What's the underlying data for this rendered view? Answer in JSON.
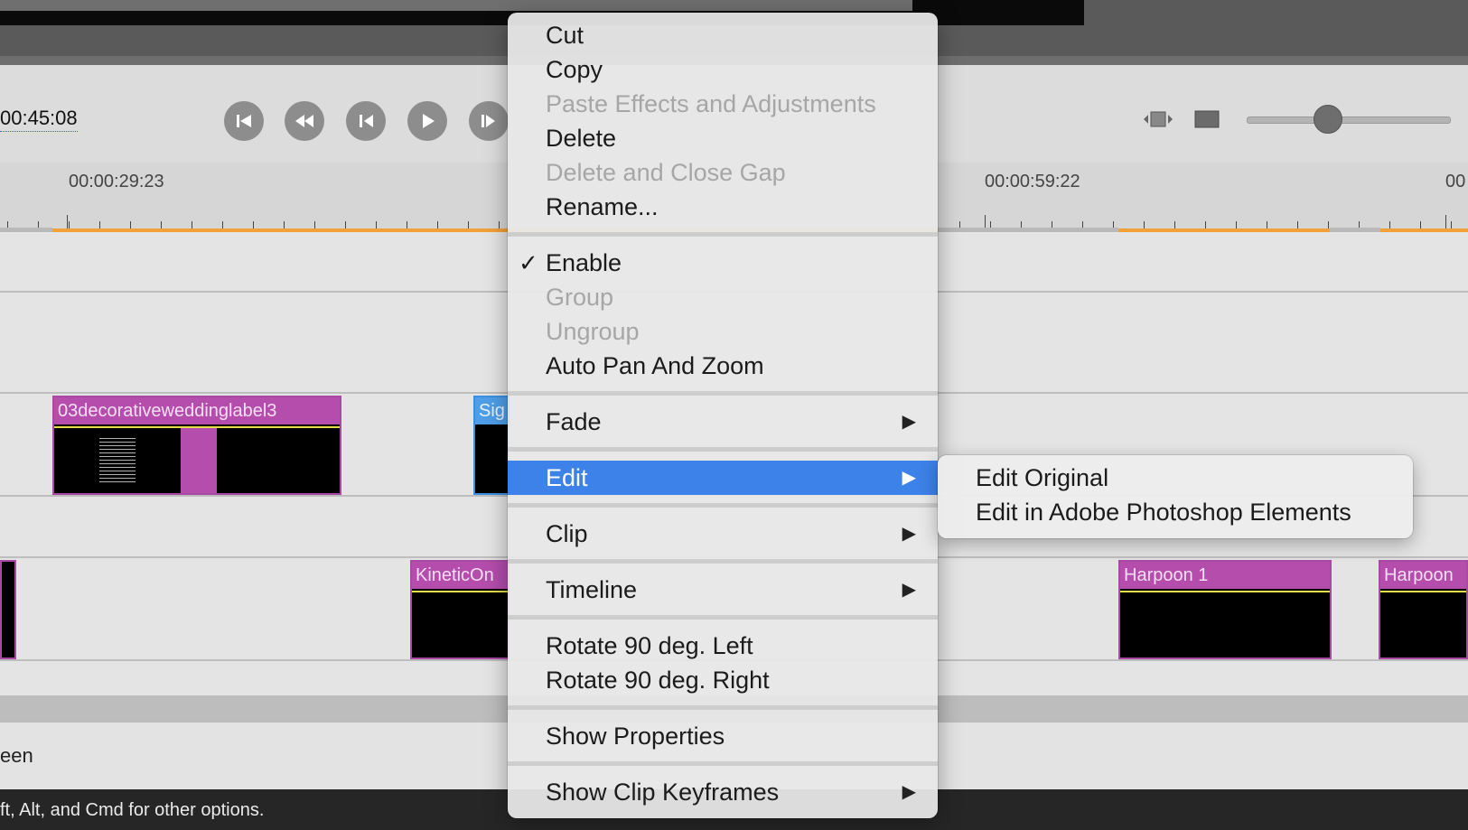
{
  "transport": {
    "timecode": "00:45:08"
  },
  "ruler": {
    "labels": [
      "00:00:29:23",
      "00:00:59:22",
      "00"
    ]
  },
  "tracks": {
    "clips": [
      {
        "name": "03decorativeweddinglabel3",
        "color": "#b44dac"
      },
      {
        "name": "Sig",
        "color": "#4f9ee8"
      },
      {
        "name": "KineticOn",
        "color": "#b44dac"
      },
      {
        "name": "Harpoon 1",
        "color": "#b44dac"
      },
      {
        "name": "Harpoon",
        "color": "#b44dac"
      }
    ]
  },
  "bottom_panel": {
    "text": "een"
  },
  "status_bar": {
    "text": "ft, Alt, and Cmd for other options."
  },
  "context_menu": {
    "items": [
      {
        "label": "Cut"
      },
      {
        "label": "Copy"
      },
      {
        "label": "Paste Effects and Adjustments",
        "disabled": true
      },
      {
        "label": "Delete"
      },
      {
        "label": "Delete and Close Gap",
        "disabled": true
      },
      {
        "label": "Rename..."
      },
      {
        "label": "Enable",
        "checked": true
      },
      {
        "label": "Group",
        "disabled": true
      },
      {
        "label": "Ungroup",
        "disabled": true
      },
      {
        "label": "Auto Pan And Zoom"
      },
      {
        "label": "Fade",
        "submenu": true
      },
      {
        "label": "Edit",
        "submenu": true,
        "selected": true
      },
      {
        "label": "Clip",
        "submenu": true
      },
      {
        "label": "Timeline",
        "submenu": true
      },
      {
        "label": "Rotate 90 deg. Left"
      },
      {
        "label": "Rotate 90 deg. Right"
      },
      {
        "label": "Show Properties"
      },
      {
        "label": "Show Clip Keyframes",
        "submenu": true
      }
    ],
    "checkmark": "✓",
    "arrow": "▶"
  },
  "edit_submenu": {
    "items": [
      {
        "label": "Edit Original"
      },
      {
        "label": "Edit in Adobe Photoshop Elements"
      }
    ]
  },
  "colors": {
    "accent": "#3d82e8",
    "clip": "#b44dac",
    "ruler_line": "#f2a03a"
  }
}
